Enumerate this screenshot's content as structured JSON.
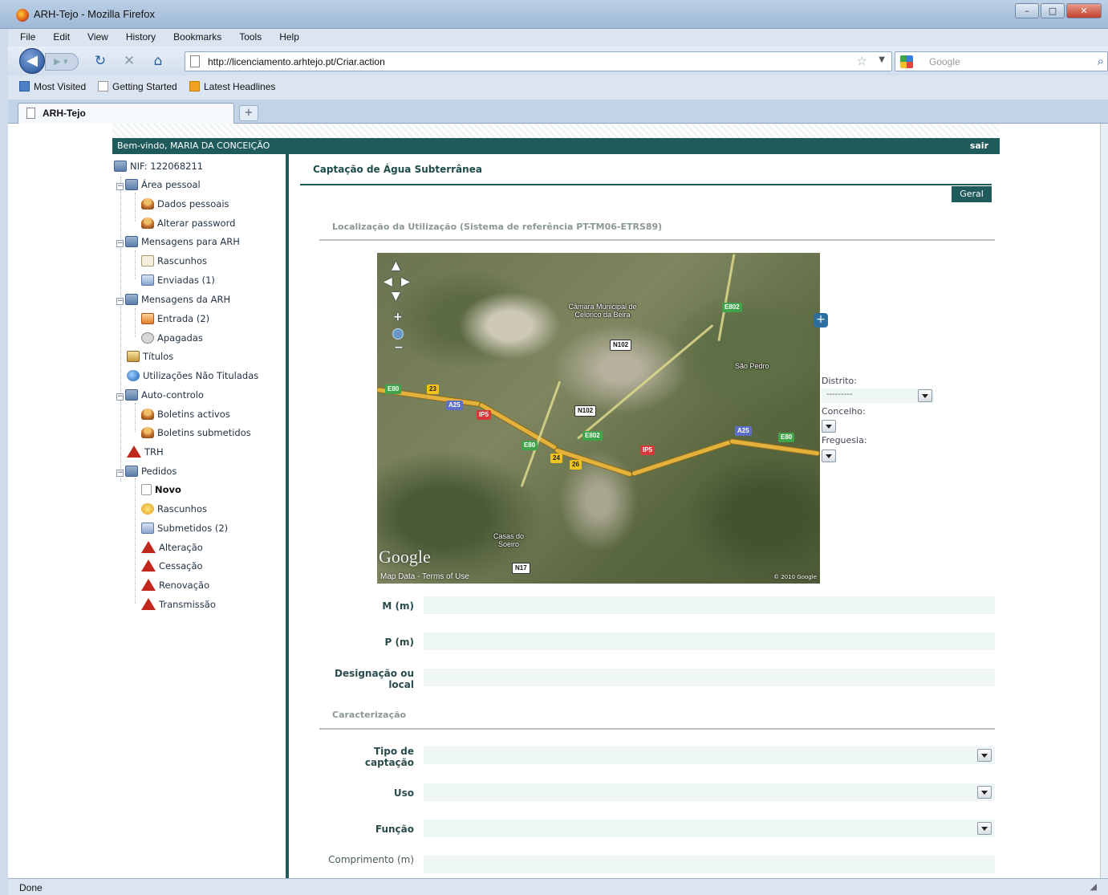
{
  "window": {
    "title": "ARH-Tejo - Mozilla Firefox"
  },
  "menu": [
    "File",
    "Edit",
    "View",
    "History",
    "Bookmarks",
    "Tools",
    "Help"
  ],
  "nav": {
    "url": "http://licenciamento.arhtejo.pt/Criar.action",
    "search_placeholder": "Google"
  },
  "bookmarks": [
    "Most Visited",
    "Getting Started",
    "Latest Headlines"
  ],
  "tab": {
    "title": "ARH-Tejo",
    "new_tab": "+"
  },
  "status": {
    "text": "Done"
  },
  "page": {
    "welcome": "Bem-vindo, MARIA DA CONCEIÇÃO",
    "logout": "sair",
    "tree": {
      "nif": "NIF: 122068211",
      "area_pessoal": "Área pessoal",
      "dados_pessoais": "Dados pessoais",
      "alterar_password": "Alterar password",
      "mensagens_para": "Mensagens para ARH",
      "rascunhos": "Rascunhos",
      "enviadas": "Enviadas (1)",
      "mensagens_da": "Mensagens da ARH",
      "entrada": "Entrada (2)",
      "apagadas": "Apagadas",
      "titulos": "Títulos",
      "utilizacoes": "Utilizações Não Tituladas",
      "auto_controlo": "Auto-controlo",
      "boletins_activos": "Boletins activos",
      "boletins_submetidos": "Boletins submetidos",
      "trh": "TRH",
      "pedidos": "Pedidos",
      "novo": "Novo",
      "rascunhos2": "Rascunhos",
      "submetidos": "Submetidos (2)",
      "alteracao": "Alteração",
      "cessacao": "Cessação",
      "renovacao": "Renovação",
      "transmissao": "Transmissão"
    },
    "title": "Captação de Água Subterrânea",
    "tab_geral": "Geral",
    "section_location": "Localização da Utilização (Sistema de referência PT-TM06-ETRS89)",
    "section_caract": "Caracterização",
    "map": {
      "logo": "Google",
      "terms": "Map Data - Terms of Use",
      "scale": "© 2010 Google",
      "places": [
        "Câmara Municipal de Celorico da Beira",
        "São Pedro",
        "Casas do Soeiro"
      ],
      "shields": [
        "E80",
        "A25",
        "IP5",
        "E802",
        "N102",
        "N17",
        "23",
        "24",
        "26"
      ]
    },
    "side": {
      "distrito_label": "Distrito:",
      "distrito_value": "---------",
      "concelho_label": "Concelho:",
      "freguesia_label": "Freguesia:"
    },
    "fields": {
      "m": "M (m)",
      "p": "P (m)",
      "designacao": "Designação ou local",
      "tipo": "Tipo de captação",
      "uso": "Uso",
      "funcao": "Função",
      "comprimento": "Comprimento (m)"
    }
  }
}
